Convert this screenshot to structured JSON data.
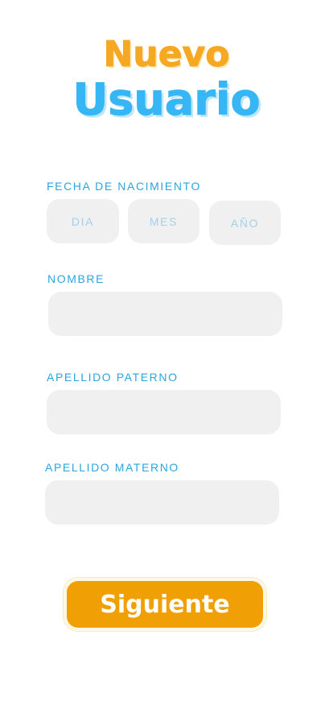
{
  "header": {
    "title_line1": "Nuevo",
    "title_line2": "Usuario"
  },
  "birthdate": {
    "label": "FECHA DE NACIMIENTO",
    "day_placeholder": "DIA",
    "month_placeholder": "MES",
    "year_placeholder": "AÑO"
  },
  "first_name": {
    "label": "NOMBRE",
    "value": ""
  },
  "paternal_surname": {
    "label": "APELLIDO PATERNO",
    "value": ""
  },
  "maternal_surname": {
    "label": "APELLIDO MATERNO",
    "value": ""
  },
  "actions": {
    "next_label": "Siguiente"
  },
  "colors": {
    "title_orange": "#f7a823",
    "title_blue": "#36b6f5",
    "label_blue": "#2aa6df",
    "field_bg": "#f0f0f0",
    "button_bg": "#f0a004"
  }
}
